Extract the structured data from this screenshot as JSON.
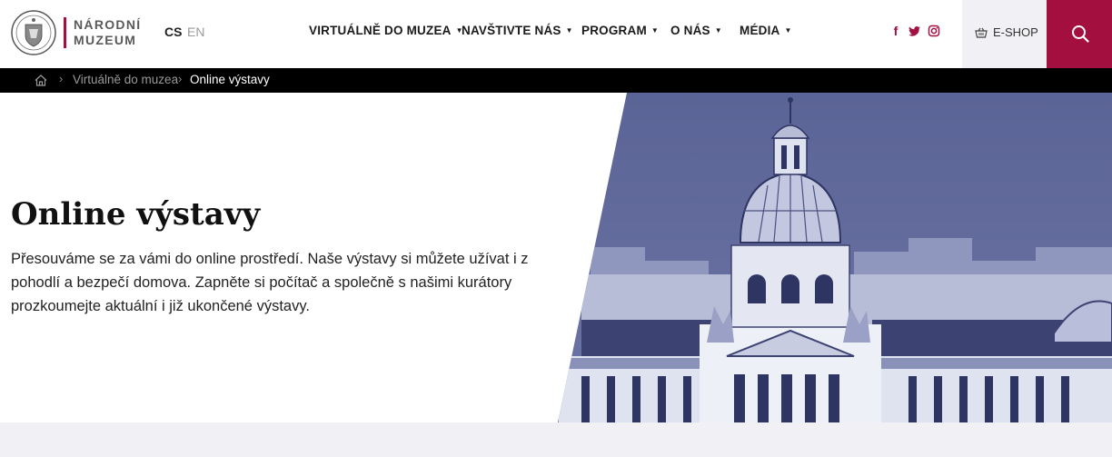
{
  "logo": {
    "line1": "NÁRODNÍ",
    "line2": "MUZEUM"
  },
  "lang": {
    "cs": "CS",
    "en": "EN"
  },
  "nav": [
    {
      "label": "VIRTUÁLNĚ DO MUZEA"
    },
    {
      "label": "NAVŠTIVTE NÁS"
    },
    {
      "label": "PROGRAM"
    },
    {
      "label": "O NÁS"
    },
    {
      "label": "MÉDIA"
    }
  ],
  "social": [
    "facebook-icon",
    "twitter-icon",
    "instagram-icon"
  ],
  "eshop": {
    "label": "E-SHOP",
    "icon": "basket-icon"
  },
  "search": {
    "icon": "search-icon"
  },
  "breadcrumb": {
    "home_icon": "home-icon",
    "items": [
      "Virtuálně do muzea",
      "Online výstavy"
    ]
  },
  "hero": {
    "title": "Online výstavy",
    "text": "Přesouváme se za vámi do online prostředí. Naše výstavy si můžete užívat i z pohodlí a bezpečí domova. Zapněte si počítač a společně s našimi kurátory prozkoumejte aktuální i již ukončené výstavy."
  },
  "colors": {
    "accent": "#a3103f",
    "photo_tint": "#5a6395",
    "breadcrumb_bg": "#000000"
  }
}
